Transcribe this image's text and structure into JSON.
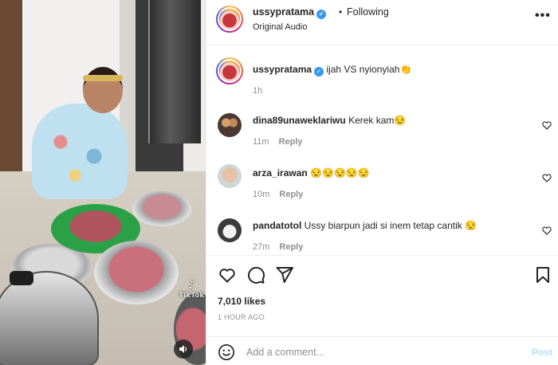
{
  "post": {
    "username": "ussypratama",
    "separator": "•",
    "following_label": "Following",
    "audio_label": "Original Audio",
    "more_label": "•••"
  },
  "caption": {
    "username": "ussypratama",
    "text": "ijah VS nyionyiah👏",
    "time": "1h"
  },
  "comments": [
    {
      "username": "dina89unaweklariwu",
      "text": "Kerek kam😒",
      "time": "11m",
      "reply_label": "Reply"
    },
    {
      "username": "arza_irawan",
      "text": "😒😒😒😒😒",
      "time": "10m",
      "reply_label": "Reply"
    },
    {
      "username": "pandatotol",
      "text": "Ussy biarpun jadi si inem tetap cantik 😒",
      "time": "27m",
      "reply_label": "Reply"
    }
  ],
  "engagement": {
    "likes": "7,010 likes",
    "posted": "1 HOUR AGO"
  },
  "add_comment": {
    "placeholder": "Add a comment...",
    "post_label": "Post"
  },
  "media": {
    "watermark": "TikTok"
  },
  "colors": {
    "verified": "#3897f0",
    "post_disabled": "#b2dffc",
    "muted_text": "#8e8e8e"
  }
}
